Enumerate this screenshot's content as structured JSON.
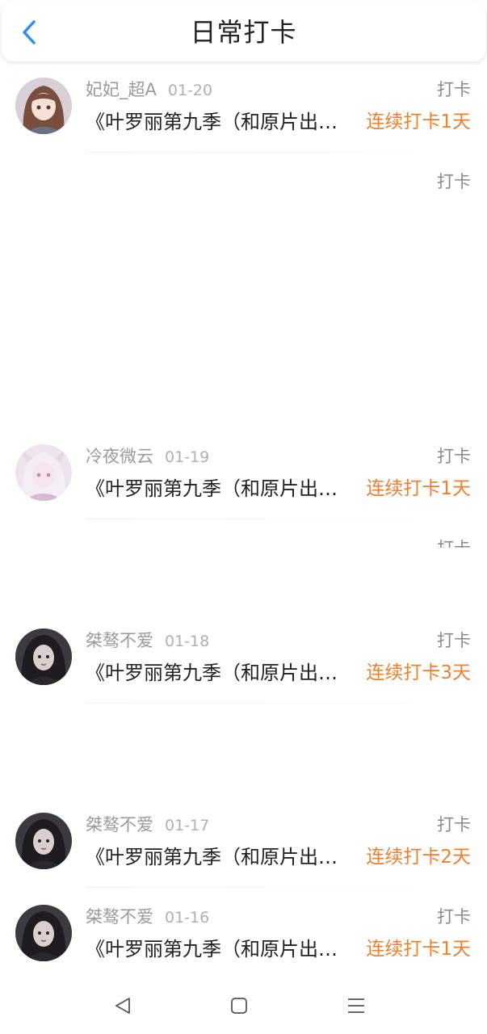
{
  "header": {
    "title": "日常打卡",
    "back_icon": "chevron-left-icon",
    "accent_color": "#2e8ff0"
  },
  "entries": [
    {
      "name": "妃妃_超A",
      "date": "01-20",
      "tag": "打卡",
      "content": "《叶罗丽第九季（和原片出…",
      "streak": "连续打卡1天",
      "avatar": "avatar-girl-brown-hair"
    },
    {
      "name": "冷夜微云",
      "date": "01-19",
      "tag": "打卡",
      "content": "《叶罗丽第九季（和原片出…",
      "streak": "连续打卡1天",
      "avatar": "avatar-girl-white-hair"
    },
    {
      "name": "桀骜不爱",
      "date": "01-18",
      "tag": "打卡",
      "content": "《叶罗丽第九季（和原片出…",
      "streak": "连续打卡3天",
      "avatar": "avatar-girl-dark"
    },
    {
      "name": "桀骜不爱",
      "date": "01-17",
      "tag": "打卡",
      "content": "《叶罗丽第九季（和原片出…",
      "streak": "连续打卡2天",
      "avatar": "avatar-girl-dark"
    },
    {
      "name": "桀骜不爱",
      "date": "01-16",
      "tag": "打卡",
      "content": "《叶罗丽第九季（和原片出…",
      "streak": "连续打卡1天",
      "avatar": "avatar-girl-dark"
    }
  ],
  "ghost_tags": [
    "打卡",
    "打卡"
  ],
  "streak_color": "#f07f2e",
  "navbar": {
    "back_icon": "triangle-back-icon",
    "home_icon": "square-home-icon",
    "menu_icon": "menu-lines-icon"
  }
}
